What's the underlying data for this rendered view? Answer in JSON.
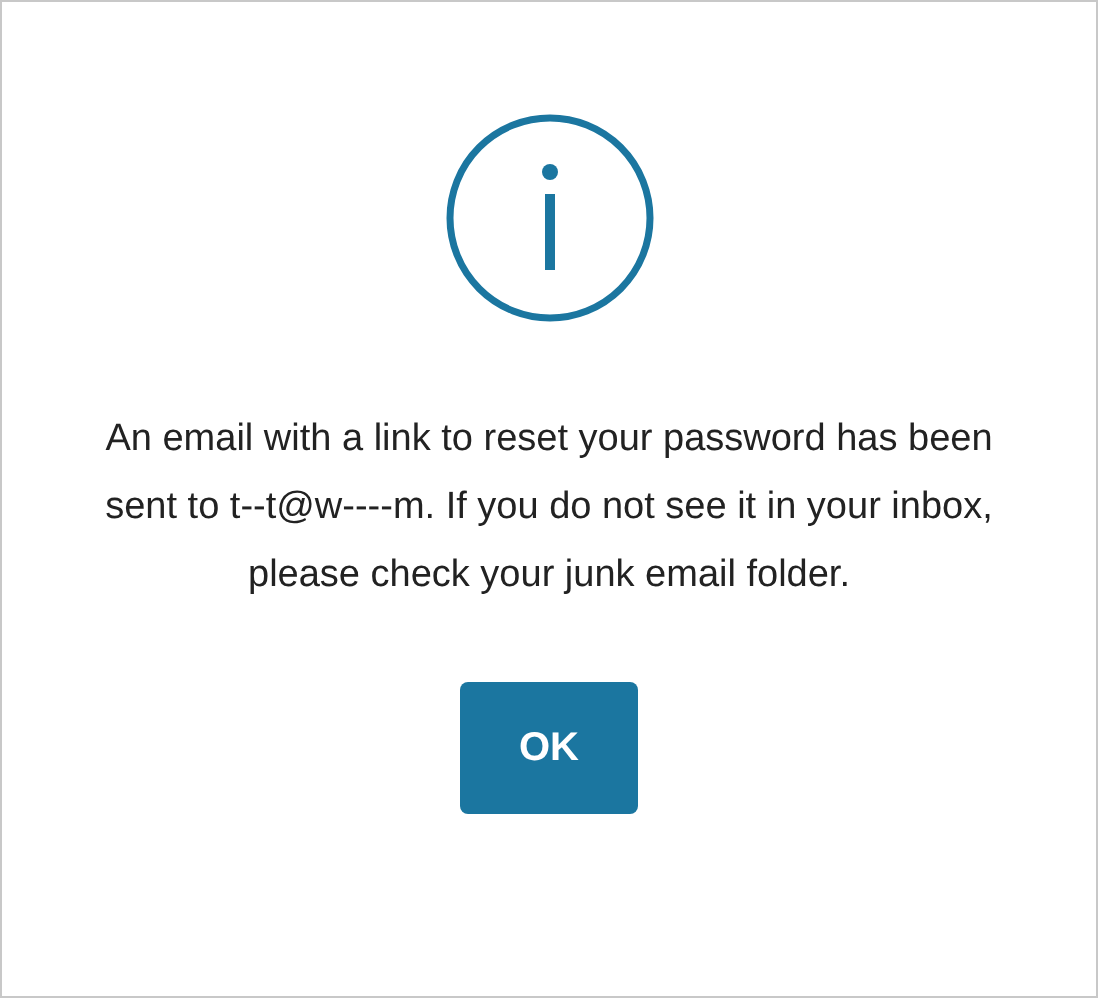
{
  "dialog": {
    "message": "An email with a link to reset your password has been sent to t--t@w----m. If you do not see it in your inbox, please check your junk email folder.",
    "buttons": [
      {
        "label": "OK"
      }
    ]
  }
}
